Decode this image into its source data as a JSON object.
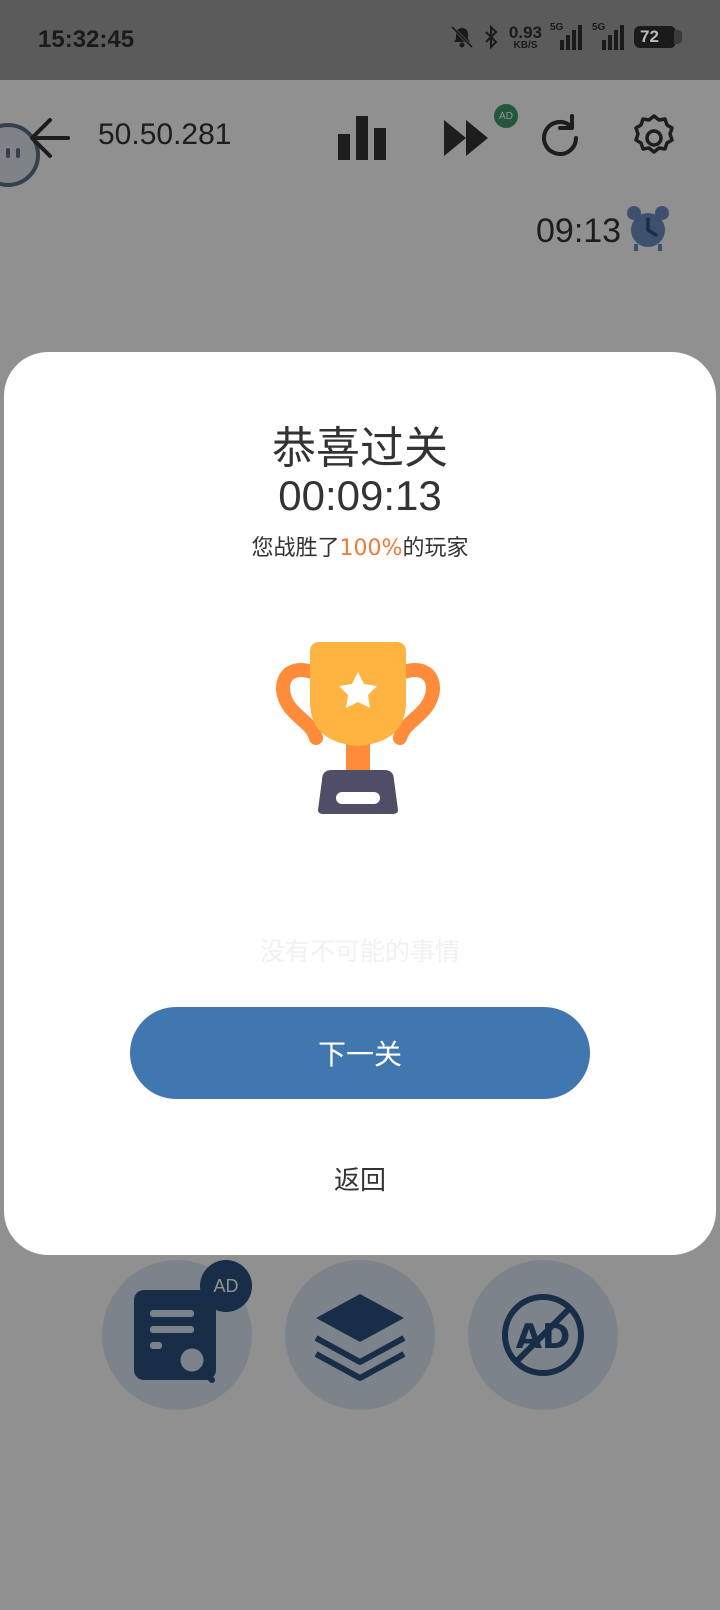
{
  "status_bar": {
    "time": "15:32:45",
    "net_speed_value": "0.93",
    "net_speed_unit": "KB/S",
    "sim1_tag": "5G",
    "sim2_tag": "5G",
    "battery": "72"
  },
  "toolbar": {
    "puzzle_id": "50.50.281",
    "ad_badge": "AD",
    "icons": [
      "back-arrow-icon",
      "stats-icon",
      "fast-forward-icon",
      "restart-icon",
      "settings-icon"
    ]
  },
  "game": {
    "timer": "09:13",
    "hint_ad_badge": "AD"
  },
  "dialog": {
    "title": "恭喜过关",
    "elapsed": "00:09:13",
    "beat_prefix": "您战胜了",
    "beat_percent": "100%",
    "beat_suffix": "的玩家",
    "motto": "没有不可能的事情",
    "next_button": "下一关",
    "back_link": "返回"
  },
  "colors": {
    "accent": "#3f77ae",
    "percent": "#ef7a3a",
    "trophy_cup": "#ffb340",
    "trophy_handle": "#ff8c3a",
    "trophy_base": "#4f4e66"
  }
}
